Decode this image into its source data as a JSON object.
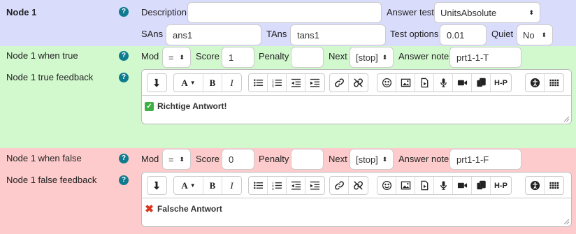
{
  "node": {
    "title": "Node 1",
    "description_label": "Description",
    "description_value": "",
    "answer_test_label": "Answer test",
    "answer_test_value": "UnitsAbsolute",
    "sans_label": "SAns",
    "sans_value": "ans1",
    "tans_label": "TAns",
    "tans_value": "tans1",
    "test_options_label": "Test options",
    "test_options_value": "0.01",
    "quiet_label": "Quiet",
    "quiet_value": "No",
    "help": "?"
  },
  "true_branch": {
    "label": "Node 1 when true",
    "feedback_label": "Node 1 true feedback",
    "mod_label": "Mod",
    "mod_value": "=",
    "score_label": "Score",
    "score_value": "1",
    "penalty_label": "Penalty",
    "penalty_value": "",
    "next_label": "Next",
    "next_value": "[stop]",
    "answer_note_label": "Answer note",
    "answer_note_value": "prt1-1-T",
    "feedback_text": "Richtige Antwort!"
  },
  "false_branch": {
    "label": "Node 1 when false",
    "feedback_label": "Node 1 false feedback",
    "mod_label": "Mod",
    "mod_value": "=",
    "score_label": "Score",
    "score_value": "0",
    "penalty_label": "Penalty",
    "penalty_value": "",
    "next_label": "Next",
    "next_value": "[stop]",
    "answer_note_label": "Answer note",
    "answer_note_value": "prt1-1-F",
    "feedback_text": "Falsche Antwort"
  },
  "toolbar": {
    "h5p_label": "H-P",
    "bold_label": "B",
    "italic_label": "I",
    "font_label": "A"
  },
  "colors": {
    "node_bg": "#dadcfc",
    "true_bg": "#d2f8ce",
    "false_bg": "#fdcbcb",
    "help_icon": "#0f7b8e"
  }
}
